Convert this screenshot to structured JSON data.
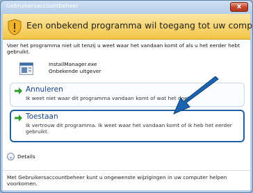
{
  "window": {
    "title": "Gebruikersaccountbeheer",
    "close_glyph": "x"
  },
  "header": {
    "text": "Een onbekend programma wil toegang tot uw computer verkrijgen"
  },
  "content": {
    "description": "Voer het programma niet uit tenzij u weet waar het vandaan komt of als u het eerder hebt gebruikt.",
    "program": {
      "name": "InstallManager.exe",
      "publisher": "Onbekende uitgever"
    }
  },
  "options": [
    {
      "title": "Annuleren",
      "description": "Ik weet niet waar dit programma vandaan komt of wat het doet."
    },
    {
      "title": "Toestaan",
      "description": "Ik vertrouw dit programma. Ik weet waar het vandaan komt of ik heb het eerder gebruikt."
    }
  ],
  "details": {
    "label": "Details"
  },
  "footer": {
    "text": "Met Gebruikersaccountbeheer kunt u ongewenste wijzigingen in uw computer helpen voorkomen."
  },
  "colors": {
    "accent": "#1e5fa0",
    "header_bg": "#f3c646",
    "arrow_green": "#2e9a2a"
  }
}
